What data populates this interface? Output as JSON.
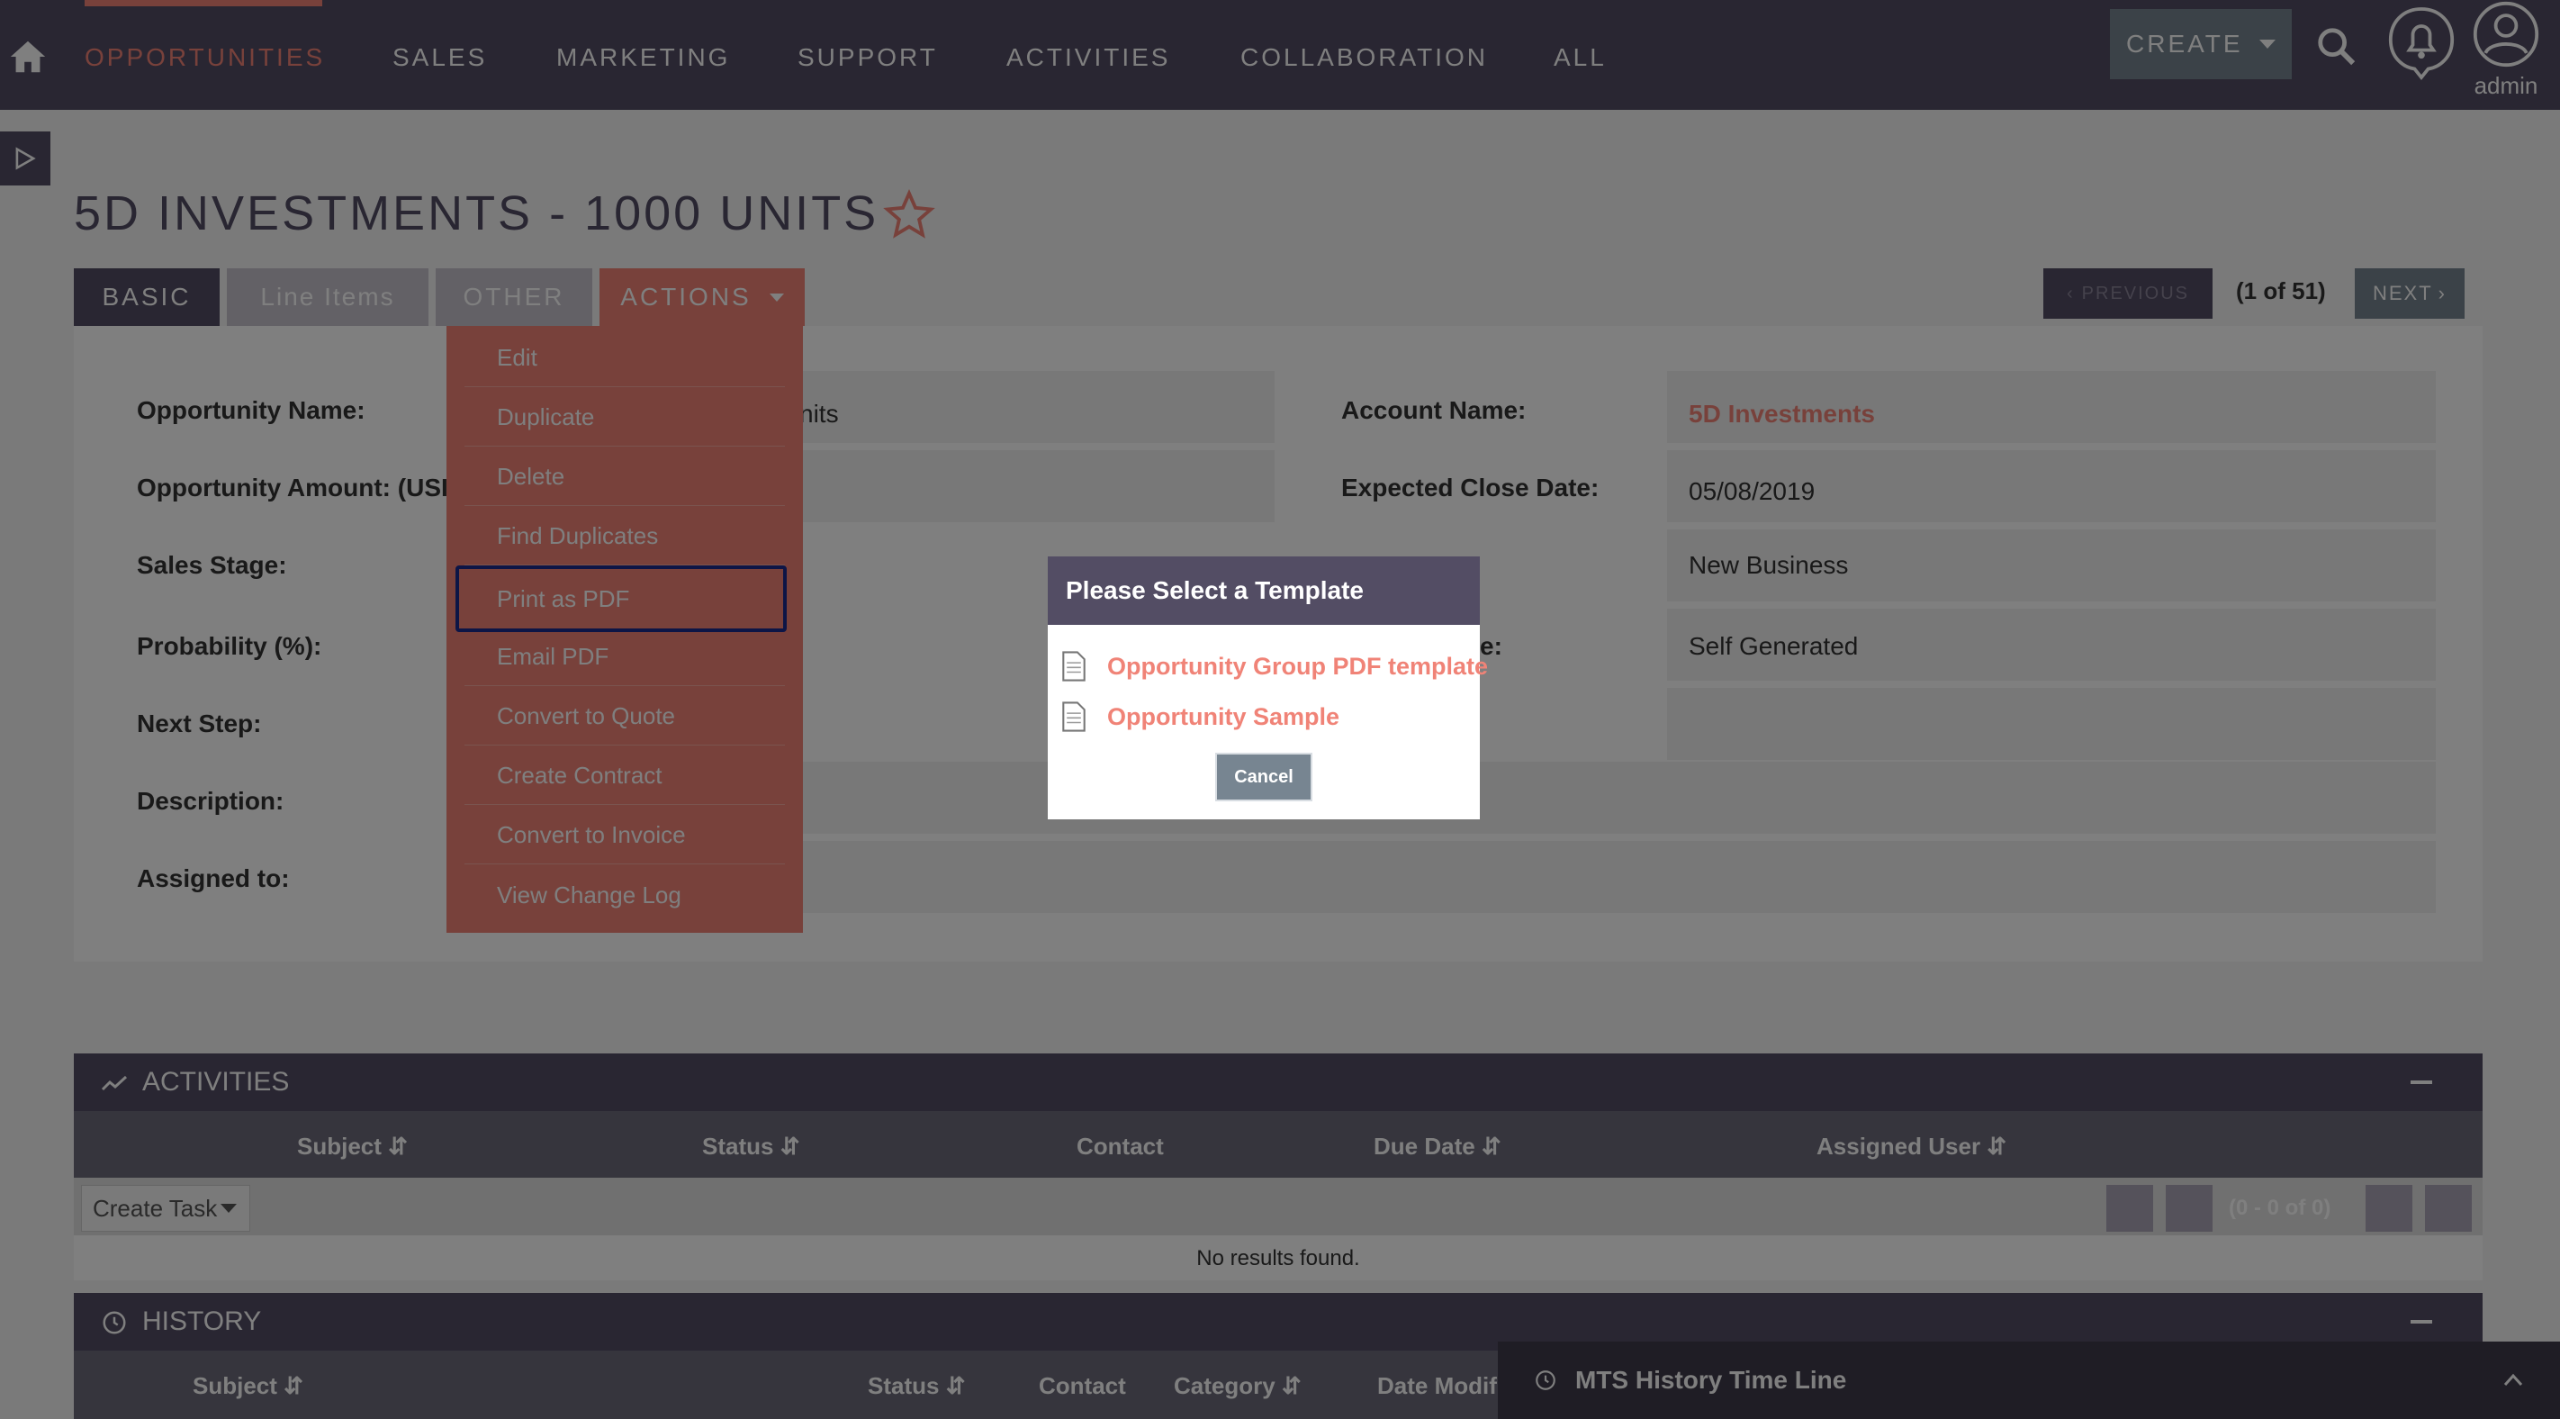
{
  "nav": {
    "items": [
      "OPPORTUNITIES",
      "SALES",
      "MARKETING",
      "SUPPORT",
      "ACTIVITIES",
      "COLLABORATION",
      "ALL"
    ],
    "create_label": "CREATE",
    "user_label": "admin"
  },
  "record": {
    "title": "5D INVESTMENTS - 1000 UNITS"
  },
  "tabs": {
    "basic": "BASIC",
    "line_items": "Line Items",
    "other": "OTHER",
    "actions": "ACTIONS"
  },
  "pager": {
    "previous": "PREVIOUS",
    "count": "(1 of 51)",
    "next": "NEXT"
  },
  "fields": {
    "opportunity_name_label": "Opportunity Name:",
    "opportunity_name_value_partial": "nits",
    "opportunity_amount_label": "Opportunity Amount: (USI",
    "sales_stage_label": "Sales Stage:",
    "probability_label": "Probability (%):",
    "next_step_label": "Next Step:",
    "description_label": "Description:",
    "assigned_to_label": "Assigned to:",
    "account_name_label": "Account Name:",
    "account_name_value": "5D Investments",
    "expected_close_label": "Expected Close Date:",
    "expected_close_value": "05/08/2019",
    "type_value": "New Business",
    "lead_source_label_partial": "e:",
    "lead_source_value": "Self Generated"
  },
  "actions_menu": [
    "Edit",
    "Duplicate",
    "Delete",
    "Find Duplicates",
    "Print as PDF",
    "Email PDF",
    "Convert to Quote",
    "Create Contract",
    "Convert to Invoice",
    "View Change Log"
  ],
  "activities": {
    "title": "ACTIVITIES",
    "columns": [
      "Subject",
      "Status",
      "Contact",
      "Due Date",
      "Assigned User"
    ],
    "create_task": "Create Task",
    "page_count": "(0 - 0 of 0)",
    "no_results": "No results found."
  },
  "history": {
    "title": "HISTORY",
    "columns": [
      "Subject",
      "Status",
      "Contact",
      "Category",
      "Date Modif"
    ]
  },
  "mts_bar": {
    "label": "MTS History Time Line"
  },
  "modal": {
    "title": "Please Select a Template",
    "templates": [
      "Opportunity Group PDF template",
      "Opportunity Sample"
    ],
    "cancel": "Cancel"
  },
  "colors": {
    "nav_bg": "#534d64",
    "accent": "#f08377",
    "button_gray": "#778591"
  }
}
